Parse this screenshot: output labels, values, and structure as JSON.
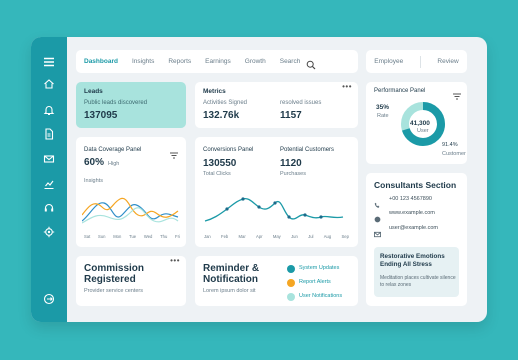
{
  "nav": {
    "items": [
      "Dashboard",
      "Insights",
      "Reports",
      "Earnings",
      "Growth",
      "Search"
    ],
    "right": [
      "Employee",
      "Review"
    ]
  },
  "leads": {
    "title": "Leads",
    "subtitle": "Public leads discovered",
    "value": "137095"
  },
  "metrics": {
    "title": "Metrics",
    "activities_label": "Activities Signed",
    "activities_value": "132.76k",
    "resolved_label": "resolved issues",
    "resolved_value": "1157"
  },
  "performance": {
    "title": "Performance Panel",
    "rate_pct": "35%",
    "rate_label": "Rate",
    "center_value": "41,300",
    "center_label": "User",
    "customer_pct": "91.4%",
    "customer_label": "Customer"
  },
  "coverage": {
    "title": "Data Coverage Panel",
    "pct": "60%",
    "pct_label": "High",
    "insights": "Insights",
    "x_labels": [
      "Sat",
      "Sun",
      "Mon",
      "Tue",
      "Wed",
      "Thu",
      "Fri"
    ]
  },
  "conversions": {
    "title": "Conversions Panel",
    "clicks_value": "130550",
    "clicks_label": "Total Clicks",
    "potential_title": "Potential Customers",
    "purchases_value": "1120",
    "purchases_label": "Purchases",
    "x_labels": [
      "Jan",
      "Feb",
      "Mar",
      "Apr",
      "May",
      "Jun",
      "Jul",
      "Aug",
      "Sep"
    ]
  },
  "consultants": {
    "title": "Consultants Section",
    "phone": "+00 123 4567890",
    "website": "www.example.com",
    "email": "user@example.com",
    "promo_title": "Restorative Emotions Ending All Stress",
    "promo_text": "Meditation places cultivate silence to relax zones"
  },
  "commission": {
    "title": "Commission Registered",
    "subtitle": "Provider service centers"
  },
  "reminder": {
    "title": "Reminder & Notification",
    "subtitle": "Lorem ipsum dolor sit",
    "legend": [
      "System Updates",
      "Report Alerts",
      "User Notifications"
    ]
  },
  "colors": {
    "teal": "#1b9aa7",
    "orange": "#f5a623",
    "light_teal": "#a8e3dd",
    "blue": "#2f8fc9"
  }
}
